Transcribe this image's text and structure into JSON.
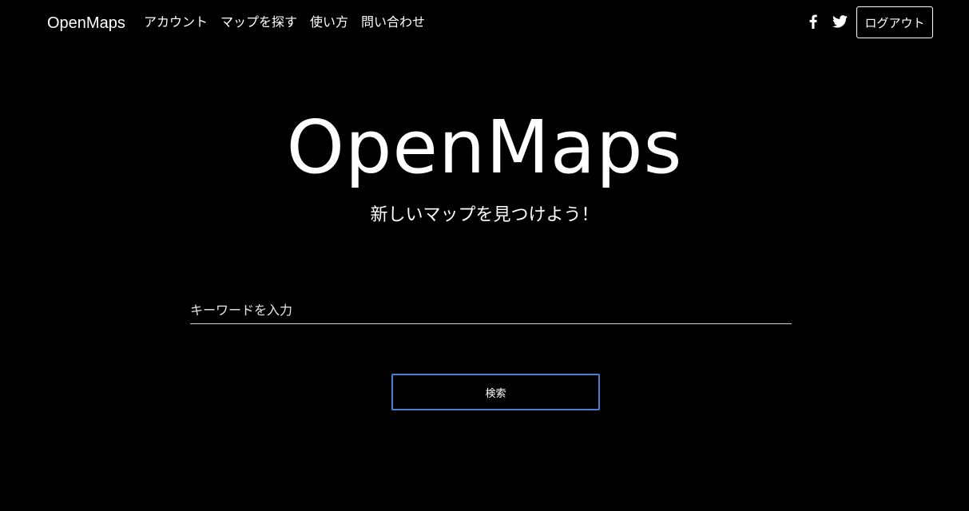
{
  "navbar": {
    "brand": "OpenMaps",
    "links": [
      {
        "label": "アカウント"
      },
      {
        "label": "マップを探す"
      },
      {
        "label": "使い方"
      },
      {
        "label": "問い合わせ"
      }
    ],
    "social": [
      {
        "icon": "facebook-icon"
      },
      {
        "icon": "twitter-icon"
      }
    ],
    "logout_label": "ログアウト"
  },
  "hero": {
    "title": "OpenMaps",
    "subtitle": "新しいマップを見つけよう！"
  },
  "search": {
    "placeholder": "キーワードを入力",
    "value": "",
    "button_label": "検索"
  },
  "colors": {
    "background": "#000000",
    "text": "#ffffff",
    "search_button_border": "#4a7fd4"
  }
}
